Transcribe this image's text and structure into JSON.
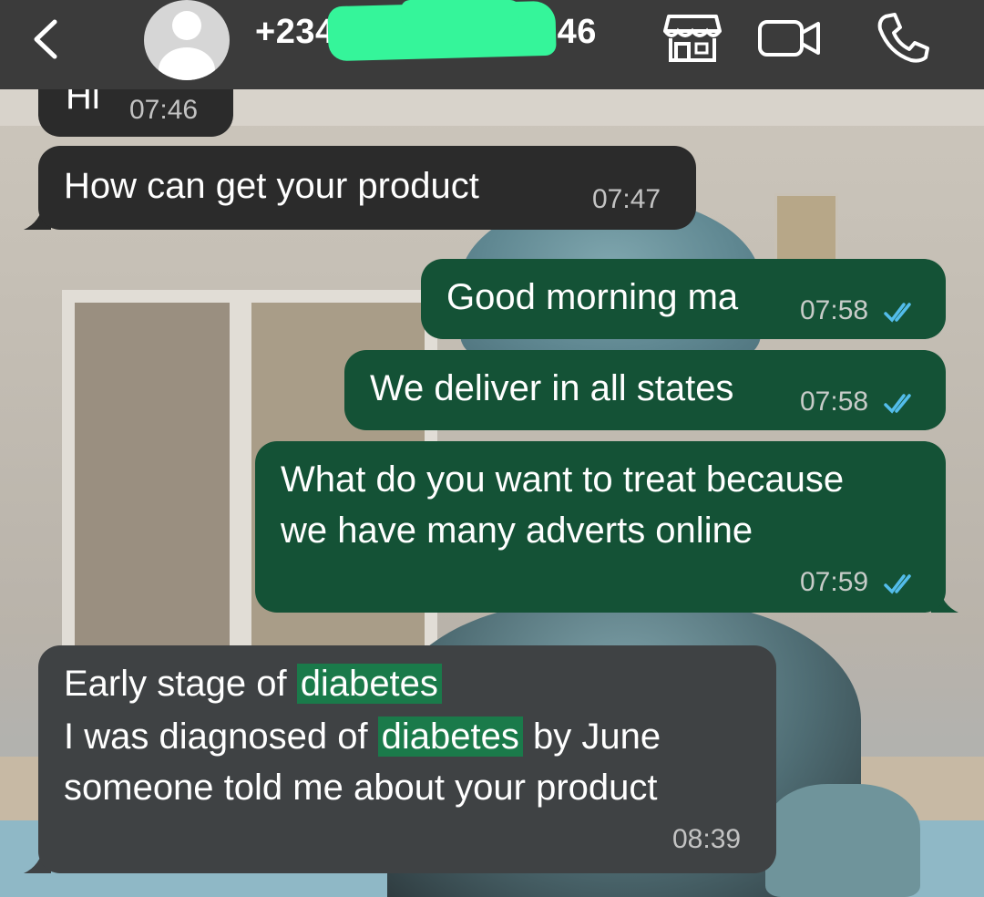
{
  "header": {
    "back_icon": "chevron-left-icon",
    "contact_prefix": "+234",
    "contact_suffix": "46",
    "icons": [
      "store-icon",
      "video-camera-icon",
      "phone-icon"
    ]
  },
  "messages": [
    {
      "direction": "in",
      "text": "Hi",
      "time": "07:46"
    },
    {
      "direction": "in",
      "text": "How can get your product",
      "time": "07:47"
    },
    {
      "direction": "out",
      "text": "Good morning ma",
      "time": "07:58",
      "status": "read"
    },
    {
      "direction": "out",
      "text": "We deliver in all states",
      "time": "07:58",
      "status": "read"
    },
    {
      "direction": "out",
      "lines": [
        "What do you want to treat because",
        "we have many adverts online"
      ],
      "time": "07:59",
      "status": "read"
    },
    {
      "direction": "in",
      "line1_a": "Early stage of ",
      "line1_hl": "diabetes",
      "line2_a": "I was diagnosed of ",
      "line2_hl": "diabetes",
      "line2_b": " by June",
      "line3": "someone told me about your product",
      "time": "08:39"
    }
  ],
  "colors": {
    "header_bg": "#3b3b3b",
    "incoming_bubble": "#2b2b2b",
    "outgoing_bubble": "#145236",
    "read_ticks": "#53bdeb",
    "search_highlight": "#1a7a4a",
    "redaction": "#35f59a"
  }
}
